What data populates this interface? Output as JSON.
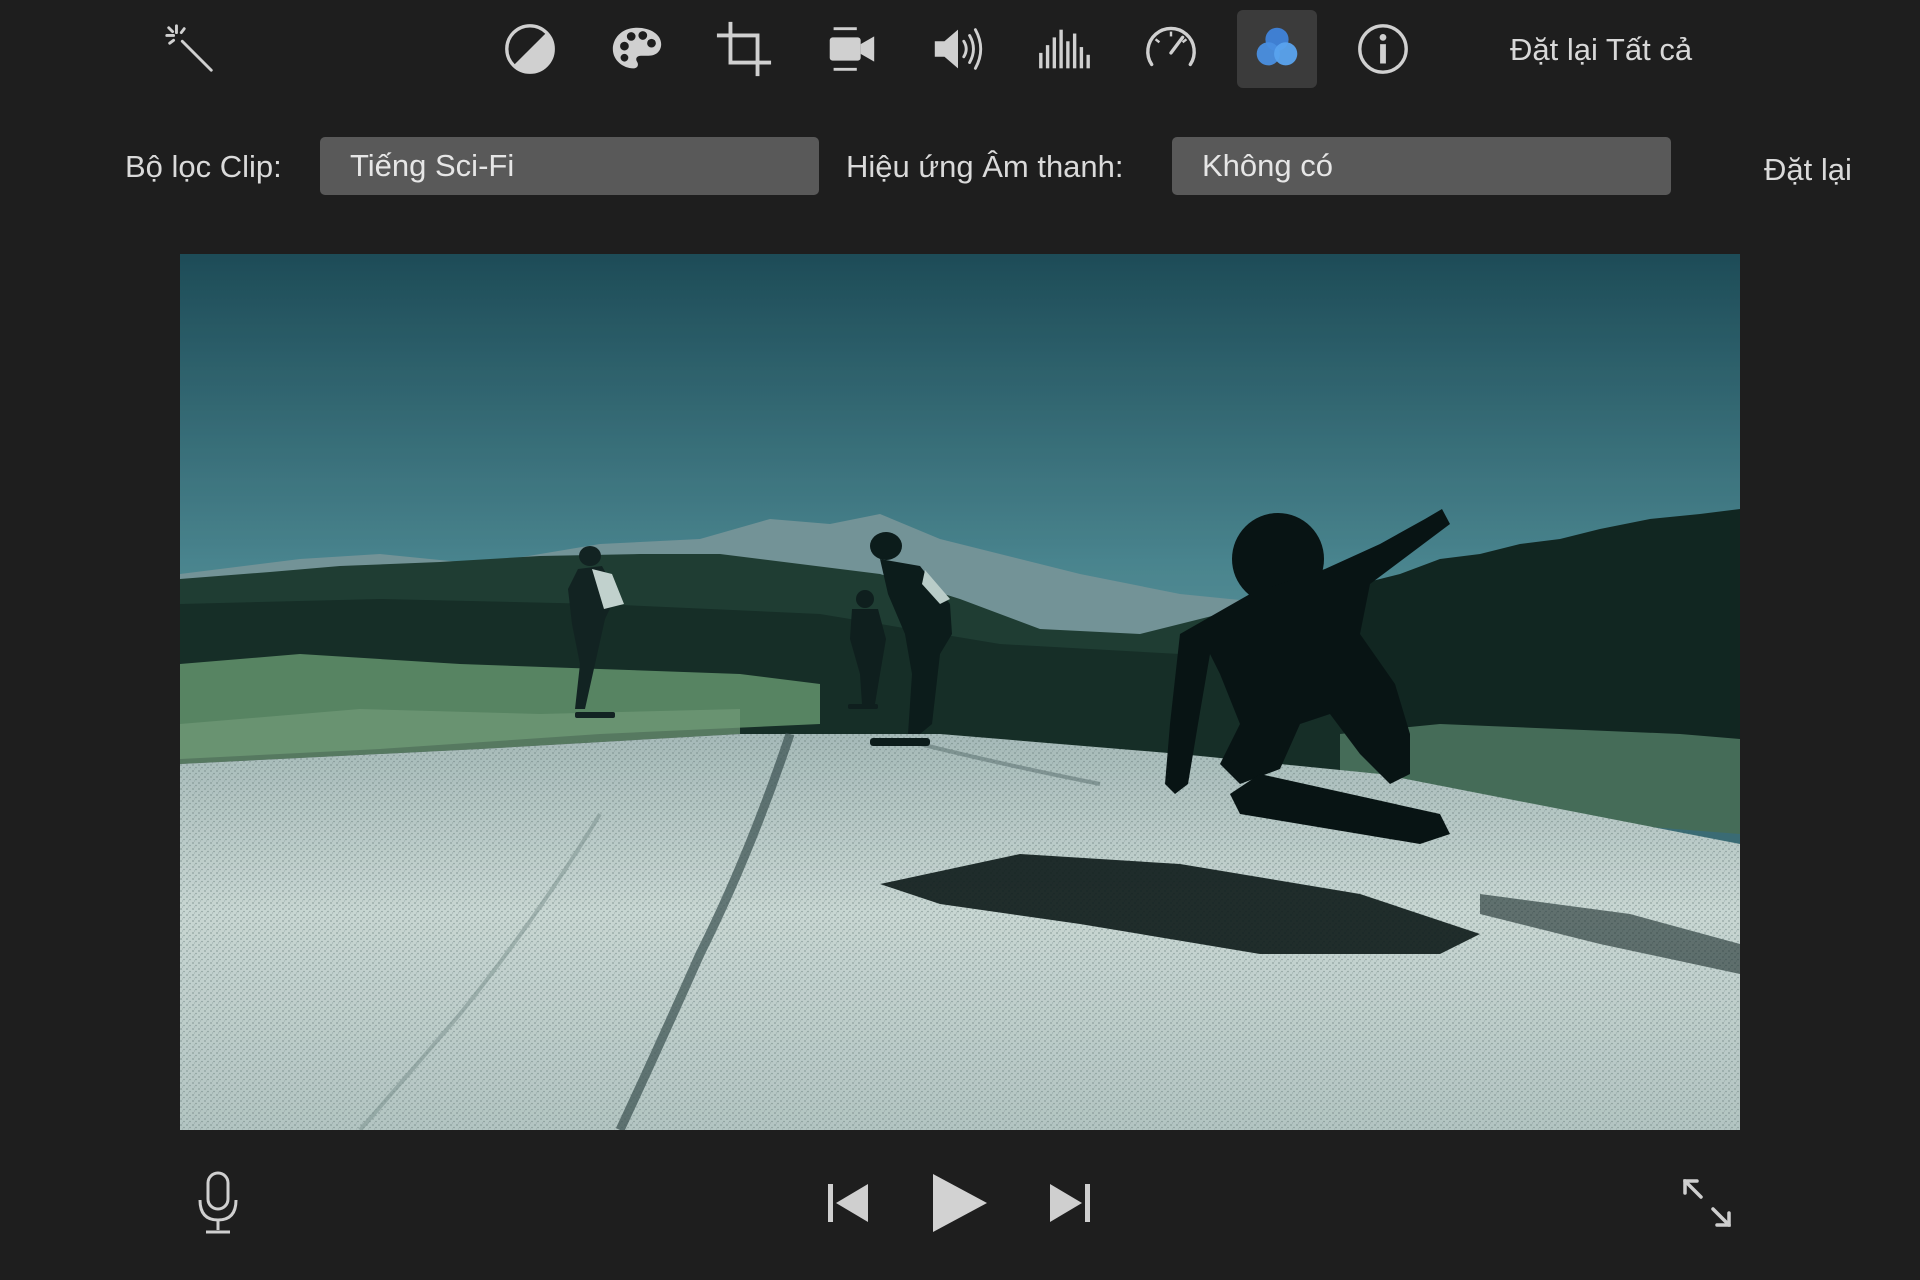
{
  "toolbar": {
    "items": [
      {
        "name": "enhance-wand-icon"
      },
      {
        "name": "color-balance-icon"
      },
      {
        "name": "color-correction-palette-icon"
      },
      {
        "name": "crop-icon"
      },
      {
        "name": "stabilization-camera-icon"
      },
      {
        "name": "volume-icon"
      },
      {
        "name": "noise-reduction-equalizer-icon"
      },
      {
        "name": "speed-gauge-icon"
      },
      {
        "name": "clip-filter-icon",
        "active": true
      },
      {
        "name": "info-icon"
      }
    ],
    "reset_all_label": "Đặt lại Tất cả"
  },
  "filter_row": {
    "clip_filter_label": "Bộ lọc Clip:",
    "clip_filter_value": "Tiếng Sci-Fi",
    "audio_effect_label": "Hiệu ứng Âm thanh:",
    "audio_effect_value": "Không có",
    "reset_label": "Đặt lại"
  },
  "viewer": {
    "content": "video-frame"
  },
  "controls": {
    "items": [
      "microphone-icon",
      "skip-back-icon",
      "play-icon",
      "skip-forward-icon",
      "fullscreen-icon"
    ]
  },
  "colors": {
    "background": "#1e1e1e",
    "dropdown_bg": "#595959",
    "active_tool_bg": "#3b3b3b",
    "icon": "#d0d0d0",
    "filter_icon_blue": "#4a8fe0"
  }
}
